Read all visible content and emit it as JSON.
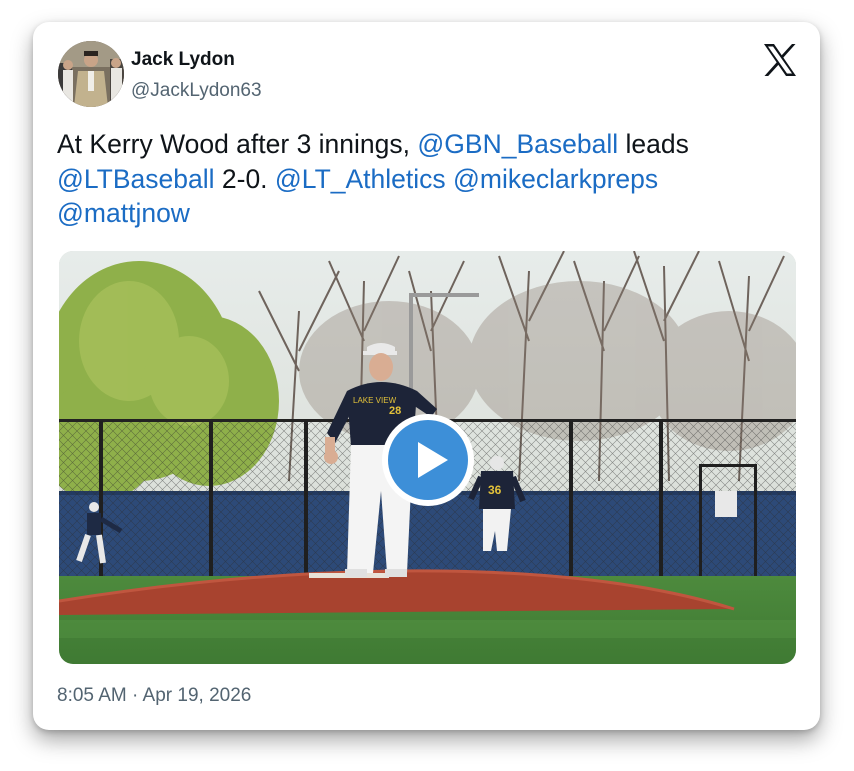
{
  "author": {
    "name": "Jack Lydon",
    "handle": "@JackLydon63"
  },
  "tweet": {
    "text_segments": [
      {
        "text": "At Kerry Wood after 3 innings, ",
        "type": "text"
      },
      {
        "text": "@GBN_Baseball",
        "type": "mention"
      },
      {
        "text": " leads ",
        "type": "text"
      },
      {
        "text": "@LTBaseball",
        "type": "mention"
      },
      {
        "text": " 2-0. ",
        "type": "text"
      },
      {
        "text": "@LT_Athletics",
        "type": "mention"
      },
      {
        "text": " ",
        "type": "text"
      },
      {
        "text": "@mikeclarkpreps",
        "type": "mention"
      },
      {
        "text": " ",
        "type": "text"
      },
      {
        "text": "@mattjnow",
        "type": "mention"
      }
    ],
    "timestamp": "8:05 AM · Apr 19, 2026"
  },
  "media": {
    "jersey_numbers": {
      "pitcher": "28",
      "fielder": "36"
    },
    "jersey_lettering": "LAKE VIEW"
  },
  "icons": {
    "brand": "x-logo-icon",
    "play": "play-icon"
  },
  "colors": {
    "mention": "#1b6cc4",
    "play_button": "#3d8fd8",
    "text": "#0f1419",
    "secondary_text": "#536471"
  }
}
